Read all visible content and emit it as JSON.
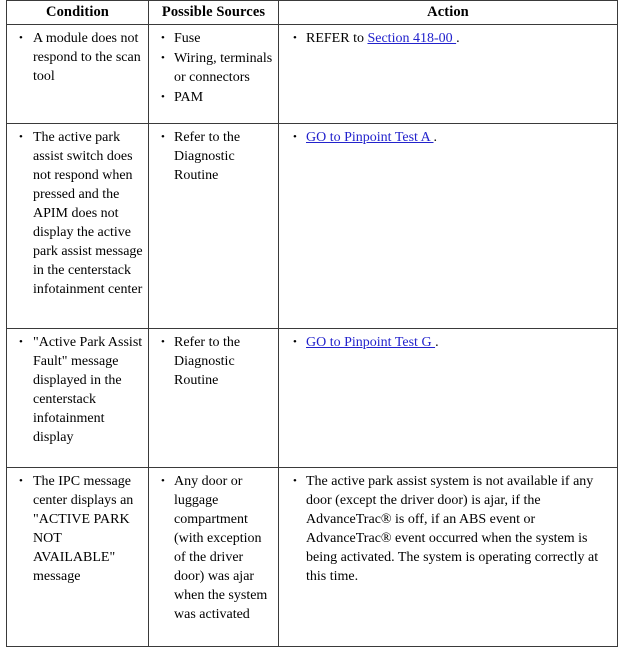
{
  "table": {
    "headers": [
      {
        "label": "Condition"
      },
      {
        "label": "Possible Sources"
      },
      {
        "label": "Action"
      }
    ],
    "link_color": "#2222cc",
    "border_color": "#3a3a3a",
    "rows": [
      {
        "condition": [
          "A module does not respond to the scan tool"
        ],
        "sources": [
          "Fuse",
          "Wiring, terminals or connectors",
          "PAM"
        ],
        "action": {
          "prefix": "REFER to ",
          "link": "Section 418-00 ",
          "suffix": "."
        }
      },
      {
        "condition": [
          "The active park assist switch does not respond when pressed and the APIM does not display the active park assist message in the centerstack infotainment center"
        ],
        "sources": [
          "Refer to the Diagnostic Routine"
        ],
        "action": {
          "prefix": "",
          "link": "GO to Pinpoint Test A ",
          "suffix": "."
        }
      },
      {
        "condition": [
          "\"Active Park Assist Fault\" message displayed in the centerstack infotainment display"
        ],
        "sources": [
          "Refer to the Diagnostic Routine"
        ],
        "action": {
          "prefix": "",
          "link": "GO to Pinpoint Test G ",
          "suffix": "."
        }
      },
      {
        "condition": [
          "The IPC message center displays an \"ACTIVE PARK NOT AVAILABLE\" message"
        ],
        "sources": [
          "Any door or luggage compartment (with exception of the driver door) was ajar when the system was activated"
        ],
        "action": {
          "prefix": "The active park assist system is not available if any door (except the driver door) is ajar, if the AdvanceTrac® is off, if an ABS event or AdvanceTrac® event occurred when the system is being activated. The system is operating correctly at this time.",
          "link": "",
          "suffix": ""
        }
      }
    ]
  }
}
